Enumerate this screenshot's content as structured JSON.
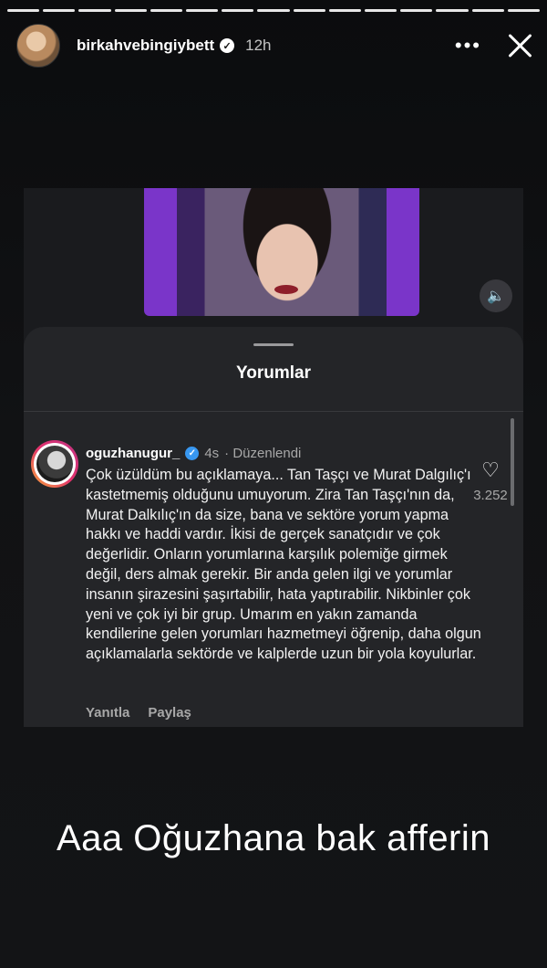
{
  "story": {
    "segments": 15,
    "username": "birkahvebingiybett",
    "time": "12h",
    "more_icon": "more-icon",
    "close_icon": "close-icon"
  },
  "post": {
    "sheet_title": "Yorumlar",
    "comment": {
      "username": "oguzhanugur_",
      "time": "4s",
      "edited": "· Düzenlendi",
      "text": "Çok üzüldüm bu açıklamaya... Tan Taşçı ve Murat Dalgılıç'ı kastetmemiş olduğunu umuyorum. Zira Tan Taşçı'nın da, Murat Dalkılıç'ın da size, bana ve sektöre yorum yapma hakkı ve haddi vardır. İkisi de gerçek sanatçıdır ve çok değerlidir. Onların yorumlarına karşılık polemiğe girmek değil, ders almak gerekir. Bir anda gelen ilgi ve yorumlar insanın şirazesini şaşırtabilir, hata yaptırabilir. Nikbinler çok yeni ve çok iyi bir grup. Umarım en yakın zamanda kendilerine gelen yorumları hazmetmeyi öğrenip, daha olgun açıklamalarla sektörde ve kalplerde uzun bir yola koyulurlar.",
      "like_count": "3.252",
      "reply_label": "Yanıtla",
      "share_label": "Paylaş"
    }
  },
  "caption": "Aaa Oğuzhana bak afferin"
}
